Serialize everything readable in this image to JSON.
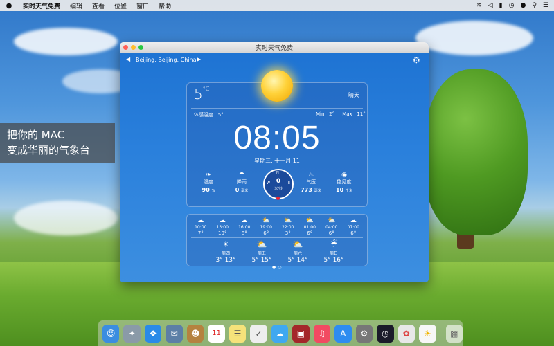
{
  "menubar": {
    "apple": "",
    "app_name": "实时天气免费",
    "items": [
      "编辑",
      "查看",
      "位置",
      "窗口",
      "帮助"
    ],
    "status_icons": [
      "wifi-icon",
      "volume-icon",
      "battery-icon",
      "clock-icon",
      "user-icon",
      "search-icon",
      "list-icon"
    ]
  },
  "caption": {
    "line1": "把你的 MAC",
    "line2": "变成华丽的气象台"
  },
  "window": {
    "title": "实时天气免费",
    "location": "Beijing, Beijing, China"
  },
  "current": {
    "temperature": "5",
    "unit": "°C",
    "condition": "晴天",
    "feels_like_label": "体感温度",
    "feels_like_value": "5°",
    "min_label": "Min",
    "min_value": "2°",
    "max_label": "Max",
    "max_value": "11°",
    "time": "08:05",
    "date": "星期三, 十一月 11"
  },
  "stats": {
    "humidity": {
      "label": "湿度",
      "value": "90",
      "unit": "%"
    },
    "rain": {
      "label": "降雨",
      "value": "0",
      "unit": "毫米"
    },
    "wind": {
      "north": "N",
      "west": "W",
      "east": "E",
      "direction_value": "0",
      "speed_unit": "米/秒"
    },
    "pressure": {
      "label": "气压",
      "value": "773",
      "unit": "毫米"
    },
    "visibility": {
      "label": "能见度",
      "value": "10",
      "unit": "千米"
    }
  },
  "hourly": [
    {
      "time": "10:00",
      "temp": "7°"
    },
    {
      "time": "13:00",
      "temp": "10°"
    },
    {
      "time": "16:00",
      "temp": "8°"
    },
    {
      "time": "19:00",
      "temp": "6°"
    },
    {
      "time": "22:00",
      "temp": "3°"
    },
    {
      "time": "01:00",
      "temp": "6°"
    },
    {
      "time": "04:00",
      "temp": "6°"
    },
    {
      "time": "07:00",
      "temp": "6°"
    }
  ],
  "daily": [
    {
      "day": "周四",
      "low": "3°",
      "high": "13°"
    },
    {
      "day": "周五",
      "low": "5°",
      "high": "15°"
    },
    {
      "day": "周六",
      "low": "5°",
      "high": "14°"
    },
    {
      "day": "周日",
      "low": "5°",
      "high": "16°"
    }
  ],
  "dock": {
    "icons": [
      "finder-icon",
      "launchpad-icon",
      "safari-icon",
      "mail-icon",
      "contacts-icon",
      "calendar-icon",
      "notes-icon",
      "reminders-icon",
      "messages-icon",
      "photo-booth-icon",
      "music-icon",
      "app-store-icon",
      "system-preferences-icon",
      "clock-app-icon",
      "photos-icon",
      "weather-app-icon",
      "trash-icon"
    ],
    "calendar_day": "11"
  }
}
